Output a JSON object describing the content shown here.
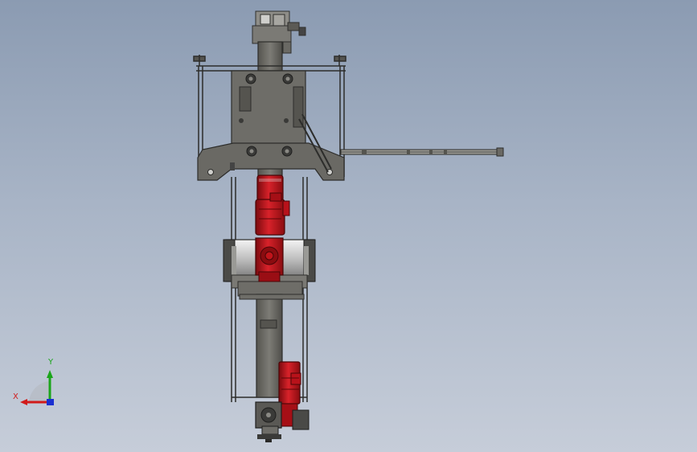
{
  "viewport": {
    "background_top": "#8b9bb2",
    "background_bottom": "#c6cdd9"
  },
  "model": {
    "frame_color": "#3a3a38",
    "steel_color": "#6b6a66",
    "motor_color": "#c0141a",
    "drum_color": "#d8d8d8"
  },
  "triad": {
    "x_label": "X",
    "y_label": "Y",
    "x_color": "#d11a1a",
    "y_color": "#1aa51a",
    "z_color": "#1a2fd1"
  }
}
